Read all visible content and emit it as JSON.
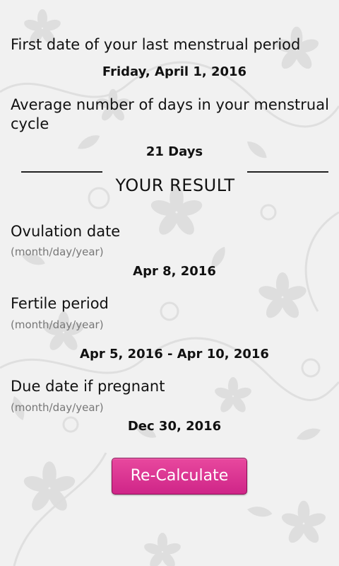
{
  "inputs": {
    "last_period_label": "First date of your last menstrual period",
    "last_period_value": "Friday, April 1, 2016",
    "cycle_label": "Average number of days in your menstrual cycle",
    "cycle_value": "21 Days"
  },
  "result": {
    "title": "YOUR RESULT",
    "ovulation": {
      "label": "Ovulation date",
      "hint": "(month/day/year)",
      "value": "Apr 8, 2016"
    },
    "fertile": {
      "label": "Fertile period",
      "hint": "(month/day/year)",
      "value": "Apr 5, 2016 - Apr 10, 2016"
    },
    "due": {
      "label": "Due date if pregnant",
      "hint": "(month/day/year)",
      "value": "Dec 30, 2016"
    }
  },
  "actions": {
    "recalculate_label": "Re-Calculate"
  },
  "colors": {
    "button": "#d92e91",
    "background": "#f1f1f1",
    "pattern": "#d8d8d8"
  }
}
